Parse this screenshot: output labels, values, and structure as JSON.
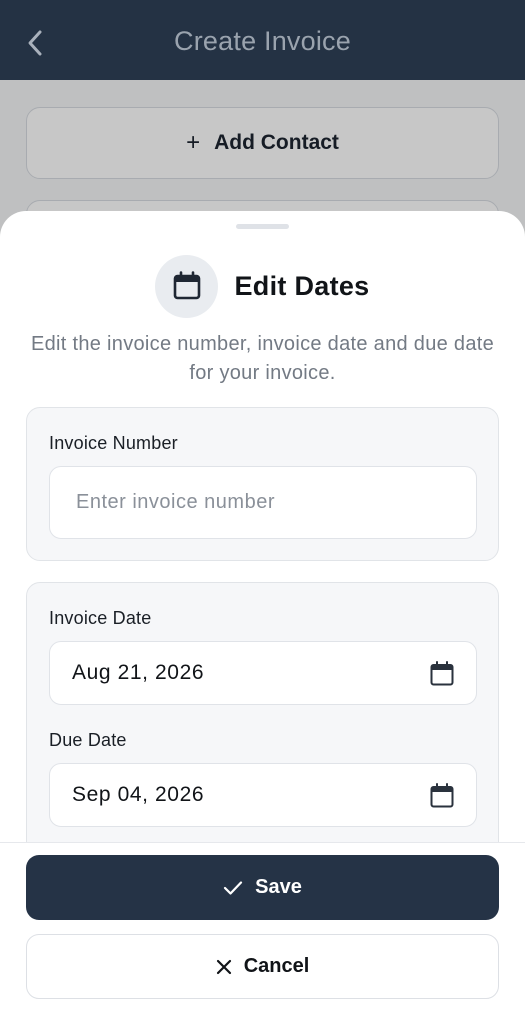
{
  "header": {
    "title": "Create Invoice",
    "back_icon": "chevron-left-icon"
  },
  "background": {
    "add_contact_label": "Add Contact",
    "add_contact_icon": "plus-icon"
  },
  "sheet": {
    "title": "Edit Dates",
    "title_icon": "calendar-icon",
    "subtitle": "Edit the invoice number, invoice date and due date for your invoice.",
    "invoice_number": {
      "label": "Invoice Number",
      "placeholder": "Enter invoice number",
      "value": ""
    },
    "invoice_date": {
      "label": "Invoice Date",
      "value": "Aug 21, 2026",
      "icon": "calendar-icon"
    },
    "due_date": {
      "label": "Due Date",
      "value": "Sep 04, 2026",
      "icon": "calendar-icon"
    }
  },
  "footer": {
    "save_label": "Save",
    "save_icon": "check-icon",
    "cancel_label": "Cancel",
    "cancel_icon": "close-icon"
  },
  "colors": {
    "header_bg": "#243244",
    "primary_button": "#253346",
    "card_bg": "#f6f7f9"
  }
}
